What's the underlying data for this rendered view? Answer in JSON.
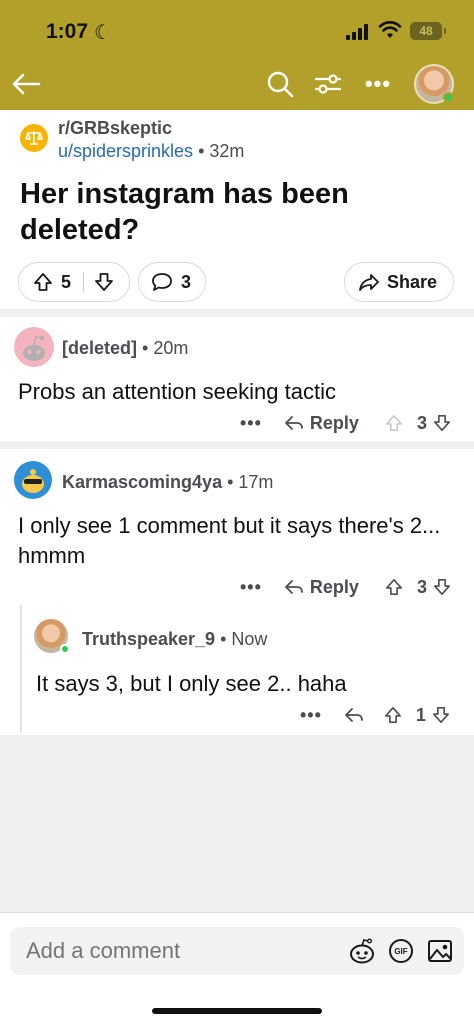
{
  "status_bar": {
    "time": "1:07",
    "battery": "48"
  },
  "post": {
    "subreddit": "r/GRBskeptic",
    "author": "u/spidersprinkles",
    "time": "32m",
    "title": "Her instagram has been deleted?",
    "votes": "5",
    "comments": "3",
    "share_label": "Share"
  },
  "comments": [
    {
      "author": "[deleted]",
      "time": "20m",
      "body": "Probs an attention seeking tactic",
      "reply_label": "Reply",
      "score": "3"
    },
    {
      "author": "Karmascoming4ya",
      "time": "17m",
      "body": "I only see 1 comment but it says there's 2... hmmm",
      "reply_label": "Reply",
      "score": "3"
    },
    {
      "author": "Truthspeaker_9",
      "time": "Now",
      "body": "It says 3, but I only see 2.. haha",
      "score": "1"
    }
  ],
  "composer": {
    "placeholder": "Add a comment",
    "gif_label": "GIF"
  },
  "icons": {
    "back": "back-arrow-icon",
    "search": "search-icon",
    "filter": "sort-filter-icon",
    "more": "more-icon",
    "upvote": "upvote-icon",
    "downvote": "downvote-icon",
    "comment": "comment-bubble-icon",
    "share": "share-arrow-icon",
    "reply": "reply-icon",
    "snoo": "snoo-icon",
    "gif": "gif-icon",
    "image": "image-icon"
  },
  "colors": {
    "header_bg": "#b3a02a",
    "link": "#2a6bb0",
    "online": "#2ecc55",
    "subreddit_icon": "#f7b500"
  }
}
